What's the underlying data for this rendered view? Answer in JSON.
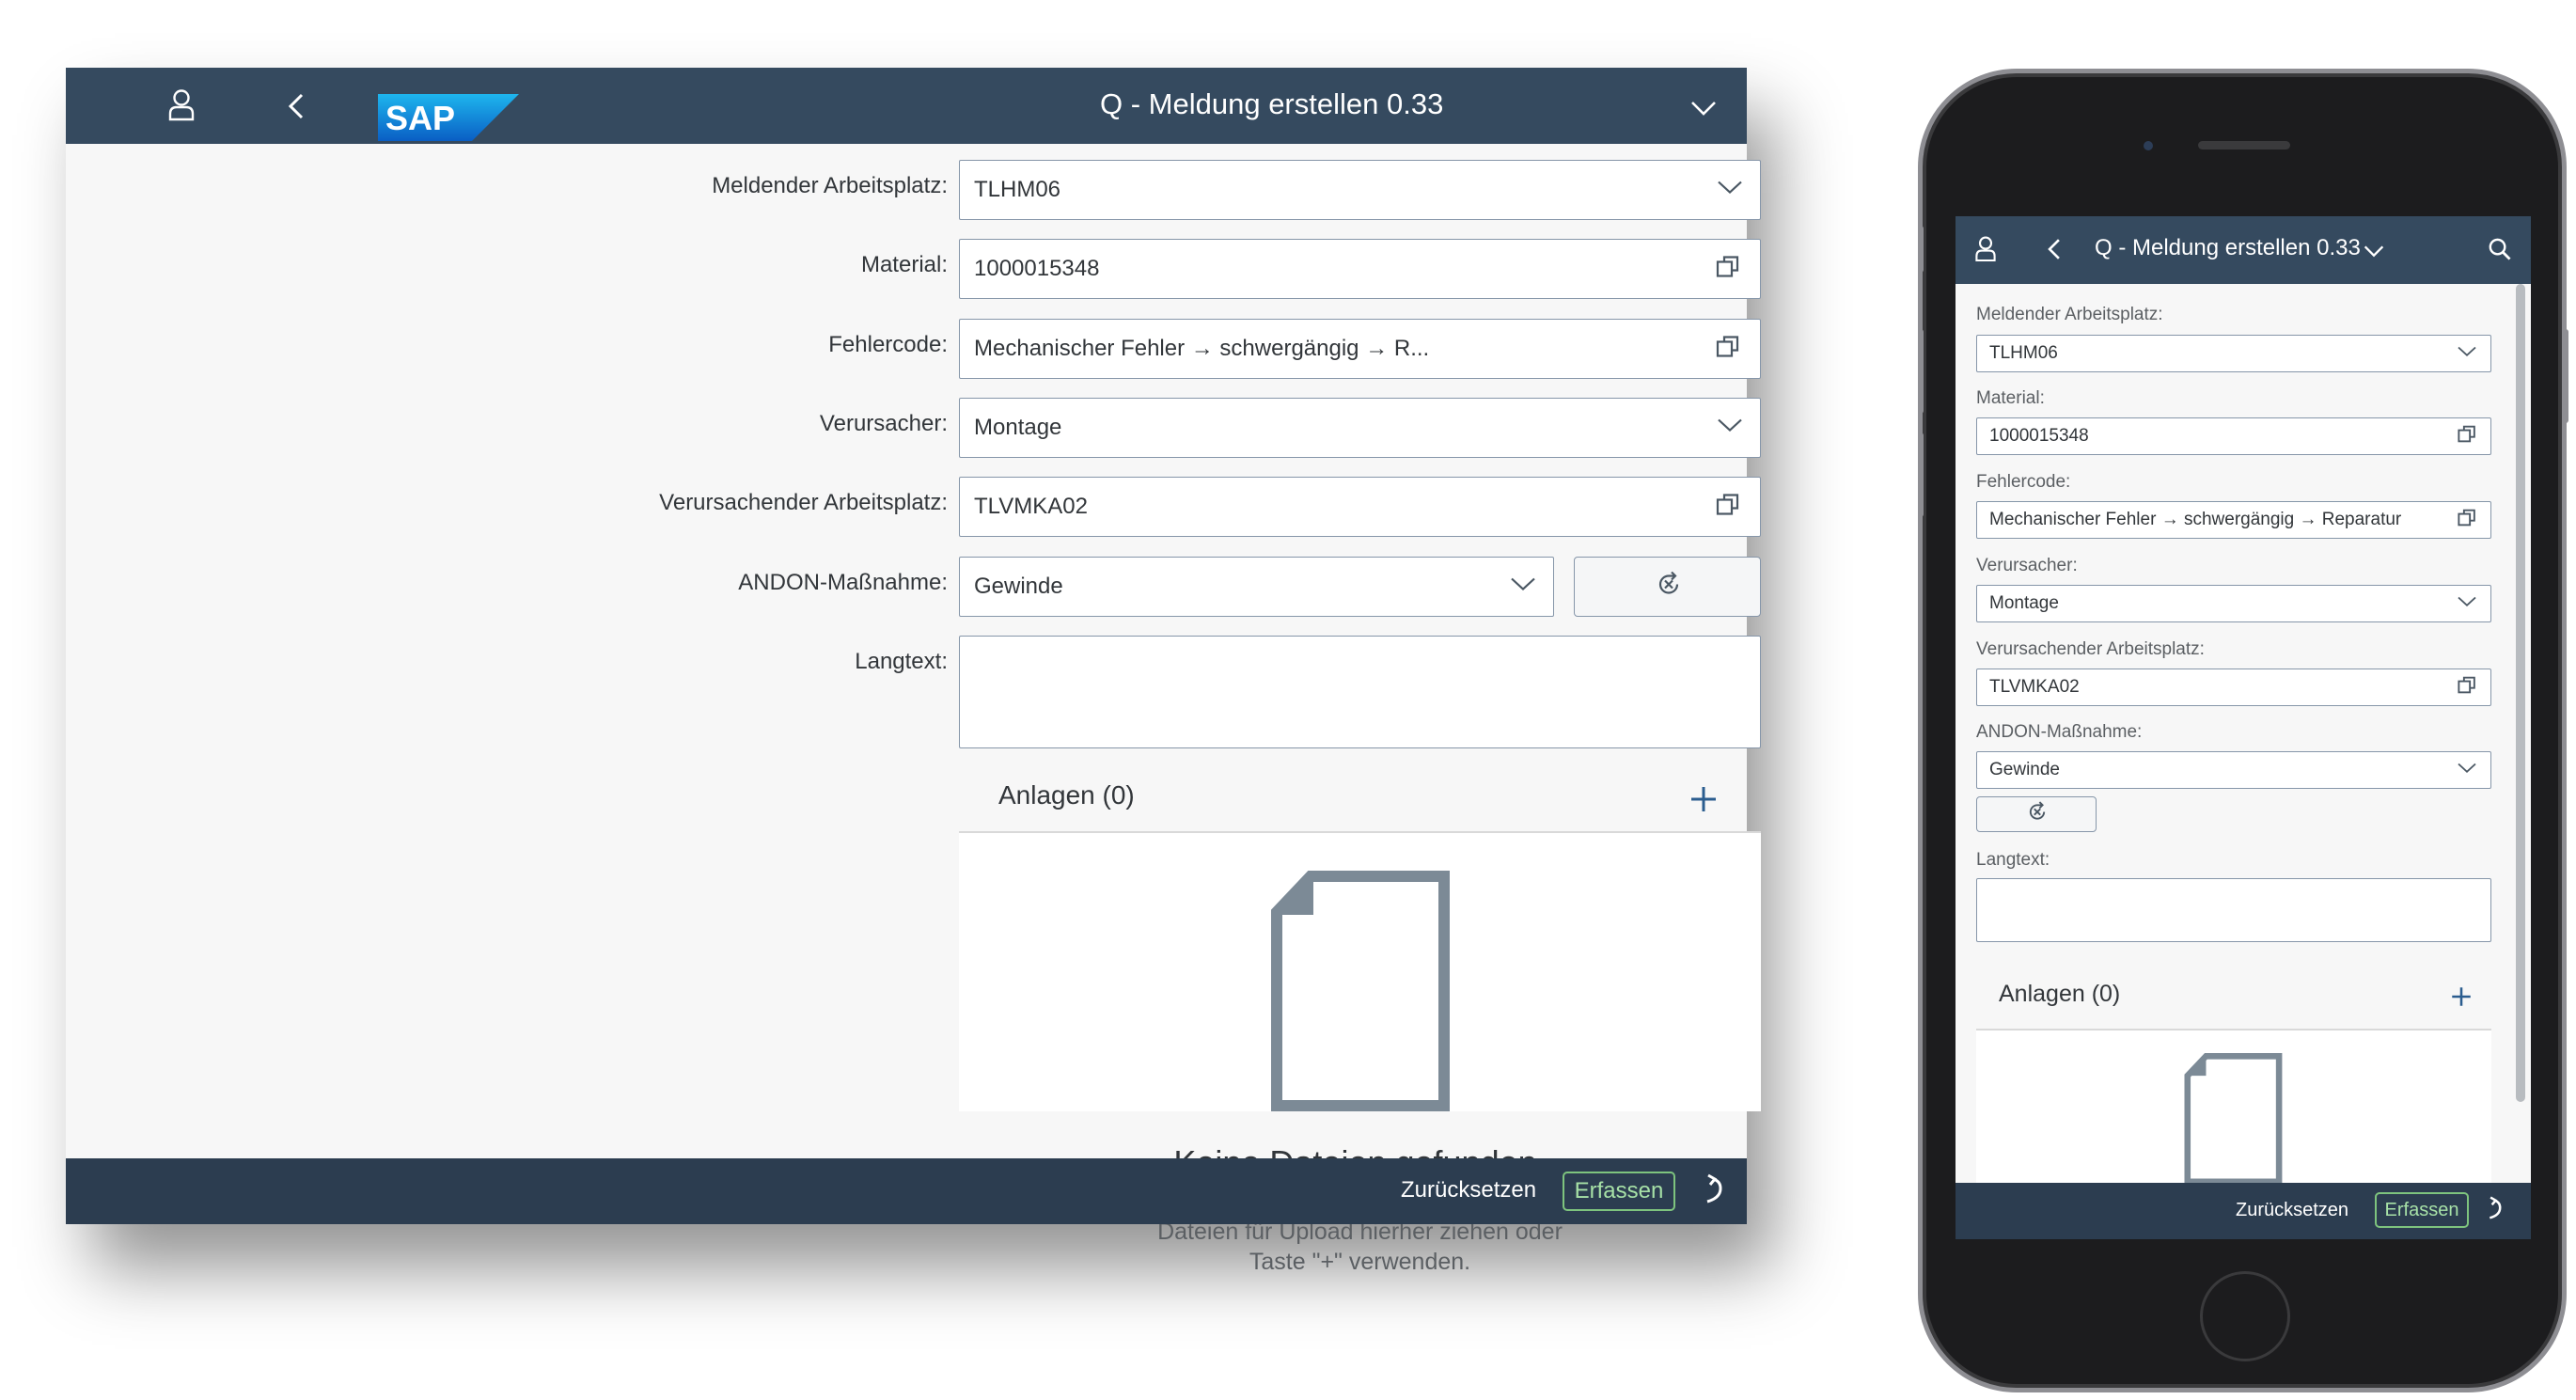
{
  "app": {
    "title": "Q - Meldung erstellen 0.33"
  },
  "form": {
    "fields": [
      {
        "label": "Meldender Arbeitsplatz:",
        "value": "TLHM06",
        "control": "dropdown"
      },
      {
        "label": "Material:",
        "value": "1000015348",
        "control": "value-help"
      },
      {
        "label": "Fehlercode:",
        "value": "Mechanischer Fehler → schwergängig → R...",
        "value_full": "Mechanischer Fehler → schwergängig → Reparatur",
        "control": "value-help"
      },
      {
        "label": "Verursacher:",
        "value": "Montage",
        "control": "dropdown"
      },
      {
        "label": "Verursachender Arbeitsplatz:",
        "value": "TLVMKA02",
        "control": "value-help"
      },
      {
        "label": "ANDON-Maßnahme:",
        "value": "Gewinde",
        "control": "dropdown"
      },
      {
        "label": "Langtext:",
        "value": "",
        "control": "textarea"
      }
    ]
  },
  "attachments": {
    "title": "Anlagen (0)",
    "empty_title": "Keine Dateien gefunden.",
    "empty_line1": "Dateien für Upload hierher ziehen oder",
    "empty_line2": "Taste \"+\" verwenden."
  },
  "footer": {
    "reset_label": "Zurücksetzen",
    "submit_label": "Erfassen"
  },
  "icons": {
    "user": "user-icon",
    "back": "back-icon",
    "logo": "sap-logo",
    "title_menu": "chevron-down-icon",
    "search": "search-icon",
    "dropdown": "chevron-down-icon",
    "value_help": "value-help-icon",
    "clear": "clear-icon",
    "add": "add-icon",
    "document": "document-icon",
    "refresh": "refresh-icon"
  },
  "colors": {
    "shell_header": "#354a5f",
    "footer_bar": "#2c3d50",
    "accent_green": "#7ec47e",
    "field_border": "#8696a9",
    "text": "#32363a"
  }
}
